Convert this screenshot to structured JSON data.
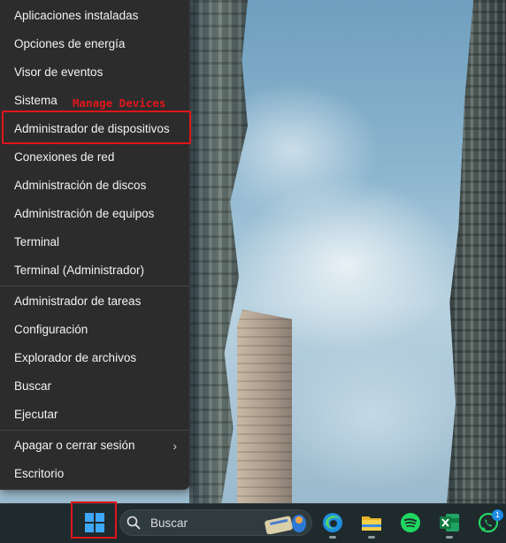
{
  "menu": {
    "items": [
      {
        "label": "Aplicaciones instaladas"
      },
      {
        "label": "Opciones de energía"
      },
      {
        "label": "Visor de eventos"
      },
      {
        "label": "Sistema"
      },
      {
        "label": "Administrador de dispositivos"
      },
      {
        "label": "Conexiones de red"
      },
      {
        "label": "Administración de discos"
      },
      {
        "label": "Administración de equipos"
      },
      {
        "label": "Terminal"
      },
      {
        "label": "Terminal (Administrador)"
      },
      {
        "label": "Administrador de tareas"
      },
      {
        "label": "Configuración"
      },
      {
        "label": "Explorador de archivos"
      },
      {
        "label": "Buscar"
      },
      {
        "label": "Ejecutar"
      },
      {
        "label": "Apagar o cerrar sesión",
        "submenu": true
      },
      {
        "label": "Escritorio"
      }
    ],
    "submenu_glyph": "›"
  },
  "annotation": {
    "text": "Manage Devices",
    "color": "#e0161c"
  },
  "taskbar": {
    "search_label": "Buscar",
    "whatsapp_badge": "1",
    "icons": [
      "windows-start-icon",
      "search-icon",
      "widget-icon",
      "edge-icon",
      "file-explorer-icon",
      "spotify-icon",
      "excel-icon",
      "whatsapp-icon"
    ]
  },
  "colors": {
    "accent": "#3ea7ff",
    "highlight": "#e0161c",
    "menu_bg": "#2c2c2c"
  }
}
